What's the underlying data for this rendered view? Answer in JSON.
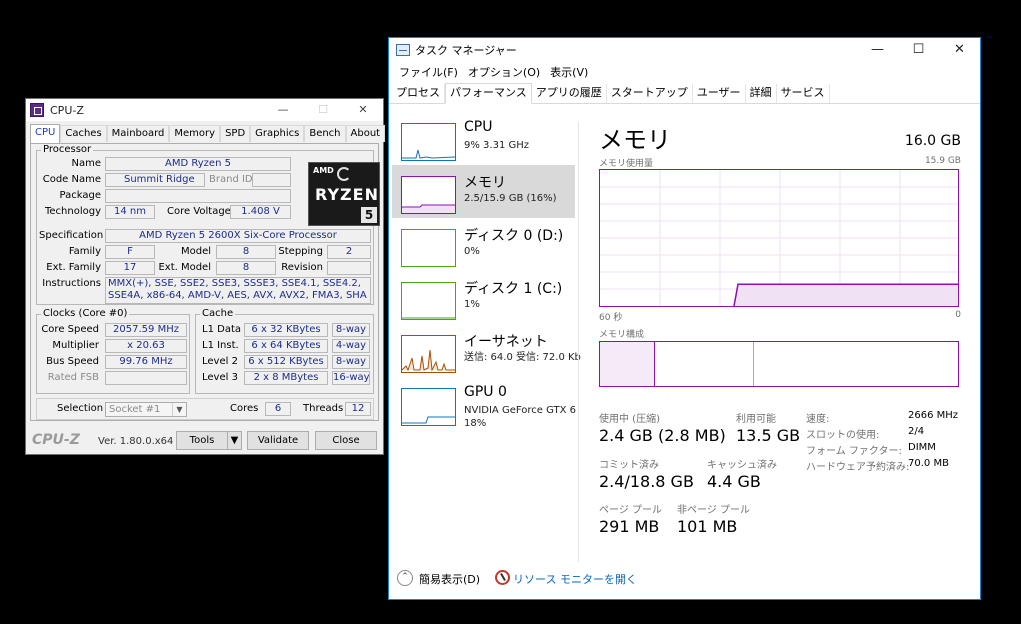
{
  "cpuz": {
    "title": "CPU-Z",
    "tabs": [
      "CPU",
      "Caches",
      "Mainboard",
      "Memory",
      "SPD",
      "Graphics",
      "Bench",
      "About"
    ],
    "processor": {
      "group_title": "Processor",
      "name_label": "Name",
      "name": "AMD Ryzen 5",
      "codename_label": "Code Name",
      "codename": "Summit Ridge",
      "brandid_label": "Brand ID",
      "brandid": "",
      "package_label": "Package",
      "package": "",
      "technology_label": "Technology",
      "technology": "14 nm",
      "corevoltage_label": "Core Voltage",
      "corevoltage": "1.408 V",
      "specification_label": "Specification",
      "specification": "AMD Ryzen 5 2600X Six-Core Processor",
      "family_label": "Family",
      "family": "F",
      "model_label": "Model",
      "model": "8",
      "stepping_label": "Stepping",
      "stepping": "2",
      "extfamily_label": "Ext. Family",
      "extfamily": "17",
      "extmodel_label": "Ext. Model",
      "extmodel": "8",
      "revision_label": "Revision",
      "revision": "",
      "instructions_label": "Instructions",
      "instructions": "MMX(+), SSE, SSE2, SSE3, SSSE3, SSE4.1, SSE4.2, SSE4A, x86-64, AMD-V, AES, AVX, AVX2, FMA3, SHA",
      "logo": {
        "amd": "AMD",
        "brand": "RYZEN",
        "number": "5"
      }
    },
    "clocks": {
      "group_title": "Clocks (Core #0)",
      "corespeed_label": "Core Speed",
      "corespeed": "2057.59 MHz",
      "multiplier_label": "Multiplier",
      "multiplier": "x 20.63",
      "busspeed_label": "Bus Speed",
      "busspeed": "99.76 MHz",
      "ratedfsb_label": "Rated FSB",
      "ratedfsb": ""
    },
    "cache": {
      "group_title": "Cache",
      "l1d_label": "L1 Data",
      "l1d": "6 x 32 KBytes",
      "l1d_way": "8-way",
      "l1i_label": "L1 Inst.",
      "l1i": "6 x 64 KBytes",
      "l1i_way": "4-way",
      "l2_label": "Level 2",
      "l2": "6 x 512 KBytes",
      "l2_way": "8-way",
      "l3_label": "Level 3",
      "l3": "2 x 8 MBytes",
      "l3_way": "16-way"
    },
    "selection": {
      "label": "Selection",
      "value": "Socket #1",
      "cores_label": "Cores",
      "cores": "6",
      "threads_label": "Threads",
      "threads": "12"
    },
    "footer": {
      "logo": "CPU-Z",
      "version": "Ver. 1.80.0.x64",
      "tools": "Tools",
      "validate": "Validate",
      "close": "Close"
    }
  },
  "tm": {
    "title": "タスク マネージャー",
    "menu": [
      "ファイル(F)",
      "オプション(O)",
      "表示(V)"
    ],
    "tabs": [
      "プロセス",
      "パフォーマンス",
      "アプリの履歴",
      "スタートアップ",
      "ユーザー",
      "詳細",
      "サービス"
    ],
    "sidebar": [
      {
        "name": "CPU",
        "detail": "9%  3.31 GHz",
        "color": "#1175ba"
      },
      {
        "name": "メモリ",
        "detail": "2.5/15.9 GB (16%)",
        "color": "#8b12ae"
      },
      {
        "name": "ディスク 0 (D:)",
        "detail": "0%",
        "color": "#4da60c"
      },
      {
        "name": "ディスク 1 (C:)",
        "detail": "1%",
        "color": "#4da60c"
      },
      {
        "name": "イーサネット",
        "detail": "送信: 64.0  受信: 72.0 Kb",
        "color": "#a74f01"
      },
      {
        "name": "GPU 0",
        "detail": "NVIDIA GeForce GTX 660",
        "detail2": "18%",
        "color": "#1175ba"
      }
    ],
    "main": {
      "title": "メモリ",
      "total": "16.0 GB",
      "usage_label": "メモリ使用量",
      "usage_max": "15.9 GB",
      "time_left": "60 秒",
      "time_right": "0",
      "composition_label": "メモリ構成",
      "usage_fraction": 0.16,
      "inuse_label": "使用中 (圧縮)",
      "inuse": "2.4 GB (2.8 MB)",
      "available_label": "利用可能",
      "available": "13.5 GB",
      "committed_label": "コミット済み",
      "committed": "2.4/18.8 GB",
      "cached_label": "キャッシュ済み",
      "cached": "4.4 GB",
      "paged_label": "ページ プール",
      "paged": "291 MB",
      "nonpaged_label": "非ページ プール",
      "nonpaged": "101 MB",
      "speed_label": "速度:",
      "speed": "2666 MHz",
      "slots_label": "スロットの使用:",
      "slots": "2/4",
      "form_label": "フォーム ファクター:",
      "form": "DIMM",
      "reserved_label": "ハードウェア予約済み:",
      "reserved": "70.0 MB"
    },
    "bottom": {
      "fewer": "簡易表示(D)",
      "resmon": "リソース モニターを開く"
    }
  }
}
